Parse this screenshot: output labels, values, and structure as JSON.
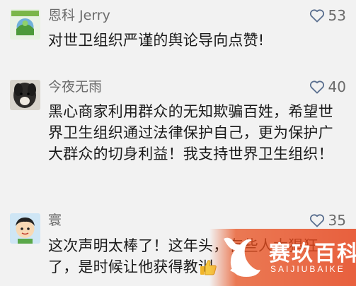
{
  "comments": [
    {
      "username": "恩科 Jerry",
      "likes": "53",
      "text": "对世卫组织严谨的舆论导向点赞!",
      "avatar": "green-landscape-avatar-icon"
    },
    {
      "username": "今夜无雨",
      "likes": "40",
      "text": "黑心商家利用群众的无知欺骗百姓，希望世界卫生组织通过法律保护自己，更为保护广大群众的切身利益！我支持世界卫生组织！",
      "avatar": "dog-photo-avatar-icon"
    },
    {
      "username": "寰",
      "likes": "35",
      "text": "这次声明太棒了！这年头，有些人太猖狂了，是时候让他获得教训",
      "avatar": "cartoon-boy-avatar-icon"
    }
  ],
  "watermark": {
    "title": "赛玖百科",
    "subtitle": "SAIJIUBAIKE"
  },
  "colors": {
    "background": "#f2f2f2",
    "text": "#1a1a1a",
    "meta": "#6b6b6b",
    "watermark": "#e8501e"
  }
}
